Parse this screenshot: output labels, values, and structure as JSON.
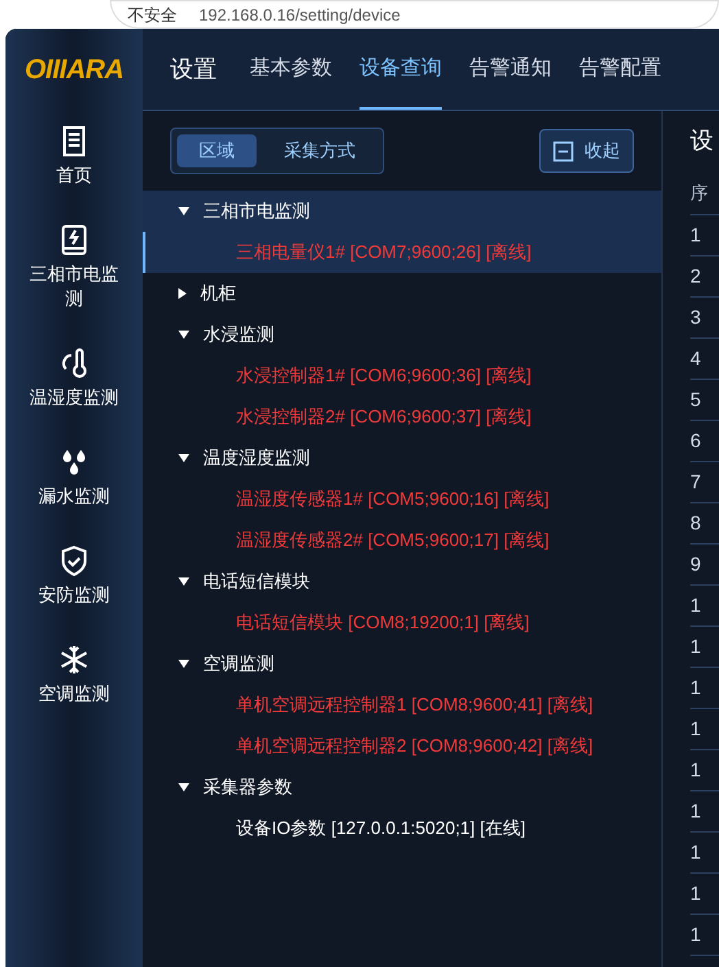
{
  "browser": {
    "security": "不安全",
    "url": "192.168.0.16/setting/device"
  },
  "logo": "OIIIARA",
  "sidebar": {
    "items": [
      {
        "label": "首页"
      },
      {
        "label": "三相市电监测"
      },
      {
        "label": "温湿度监测"
      },
      {
        "label": "漏水监测"
      },
      {
        "label": "安防监测"
      },
      {
        "label": "空调监测"
      }
    ]
  },
  "nav": {
    "title": "设置",
    "tabs": [
      {
        "label": "基本参数",
        "selected": false
      },
      {
        "label": "设备查询",
        "selected": true
      },
      {
        "label": "告警通知",
        "selected": false
      },
      {
        "label": "告警配置",
        "selected": false
      }
    ]
  },
  "toolbar": {
    "segments": [
      {
        "label": "区域",
        "selected": true
      },
      {
        "label": "采集方式",
        "selected": false
      }
    ],
    "collapse": "收起"
  },
  "tree": [
    {
      "label": "三相市电监测",
      "expanded": true,
      "selected": true,
      "children": [
        {
          "label": "三相电量仪1# [COM7;9600;26] [离线]",
          "online": false,
          "selected": true
        }
      ]
    },
    {
      "label": "机柜",
      "expanded": false,
      "selected": false
    },
    {
      "label": "水浸监测",
      "expanded": true,
      "selected": false,
      "children": [
        {
          "label": "水浸控制器1# [COM6;9600;36] [离线]",
          "online": false,
          "selected": false
        },
        {
          "label": "水浸控制器2# [COM6;9600;37] [离线]",
          "online": false,
          "selected": false
        }
      ]
    },
    {
      "label": "温度湿度监测",
      "expanded": true,
      "selected": false,
      "children": [
        {
          "label": "温湿度传感器1# [COM5;9600;16] [离线]",
          "online": false,
          "selected": false
        },
        {
          "label": "温湿度传感器2# [COM5;9600;17] [离线]",
          "online": false,
          "selected": false
        }
      ]
    },
    {
      "label": "电话短信模块",
      "expanded": true,
      "selected": false,
      "children": [
        {
          "label": "电话短信模块 [COM8;19200;1] [离线]",
          "online": false,
          "selected": false
        }
      ]
    },
    {
      "label": "空调监测",
      "expanded": true,
      "selected": false,
      "children": [
        {
          "label": "单机空调远程控制器1 [COM8;9600;41] [离线]",
          "online": false,
          "selected": false
        },
        {
          "label": "单机空调远程控制器2 [COM8;9600;42] [离线]",
          "online": false,
          "selected": false
        }
      ]
    },
    {
      "label": "采集器参数",
      "expanded": true,
      "selected": false,
      "children": [
        {
          "label": "设备IO参数 [127.0.0.1:5020;1] [在线]",
          "online": true,
          "selected": false
        }
      ]
    }
  ],
  "table": {
    "title": "设",
    "columns": [
      "序"
    ],
    "rows": [
      "1",
      "2",
      "3",
      "4",
      "5",
      "6",
      "7",
      "8",
      "9",
      "1",
      "1",
      "1",
      "1",
      "1",
      "1",
      "1",
      "1",
      "1"
    ]
  }
}
